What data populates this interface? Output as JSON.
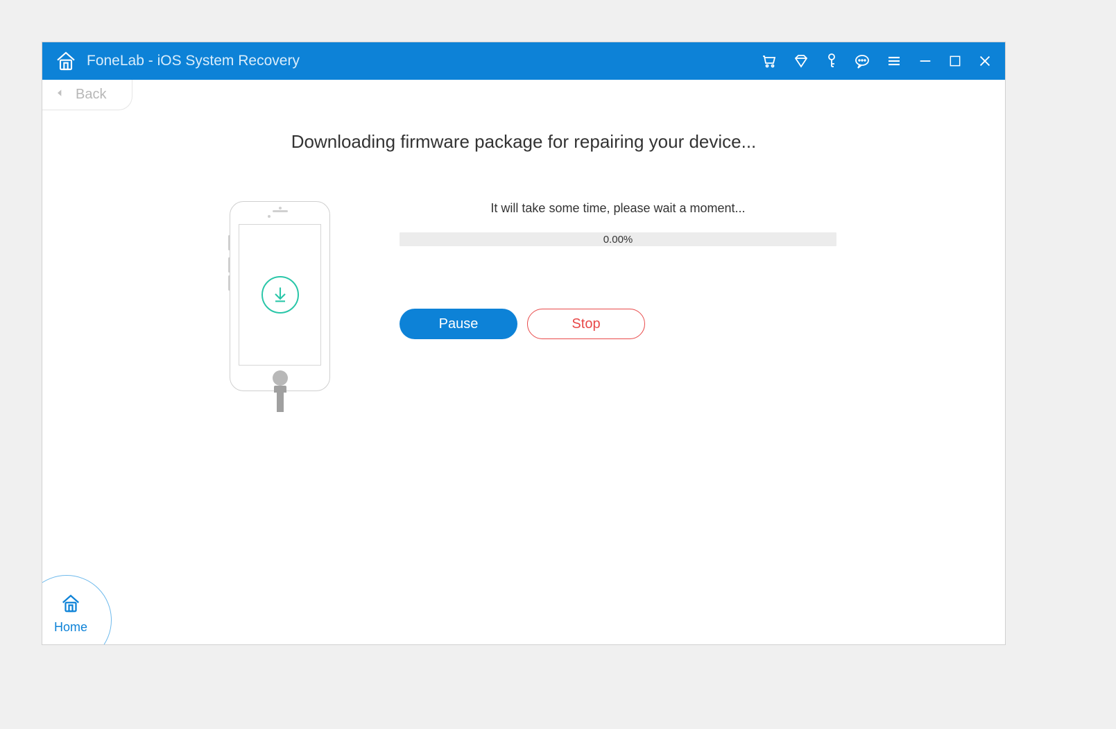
{
  "app": {
    "title": "FoneLab - iOS System Recovery"
  },
  "nav": {
    "back_label": "Back"
  },
  "main": {
    "heading": "Downloading firmware package for repairing your device...",
    "wait_text": "It will take some time, please wait a moment...",
    "progress_text": "0.00%",
    "pause_label": "Pause",
    "stop_label": "Stop"
  },
  "footer": {
    "home_label": "Home"
  }
}
